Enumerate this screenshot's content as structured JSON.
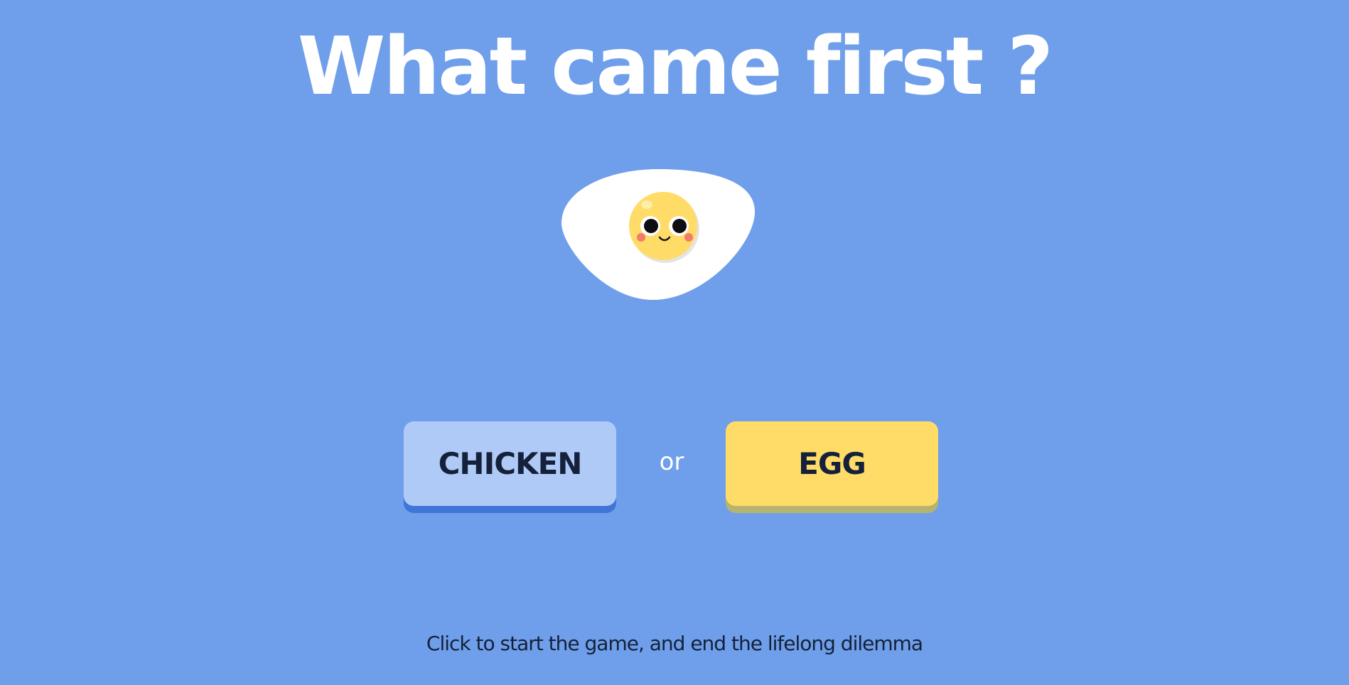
{
  "title": "What came first ?",
  "mascot": {
    "icon": "fried-egg-face-icon"
  },
  "choices": {
    "chicken_label": "CHICKEN",
    "or_label": "or",
    "egg_label": "EGG"
  },
  "instructions": "Click to start the game, and end the lifelong dilemma",
  "colors": {
    "background": "#6f9fea",
    "chicken_button": "#afcaf6",
    "egg_button": "#ffdc67",
    "text_dark": "#15213a",
    "text_light": "#ffffff"
  }
}
